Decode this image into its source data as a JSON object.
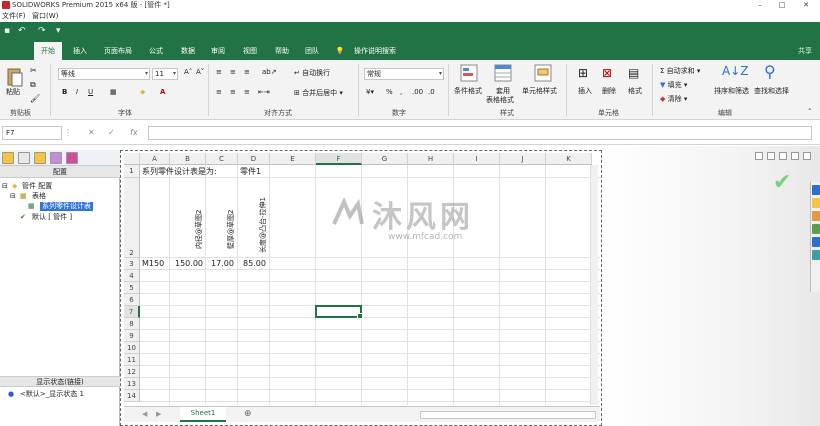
{
  "window": {
    "title": "SOLIDWORKS Premium 2015 x64 版 - [管件 *]"
  },
  "menubar": {
    "items": [
      "文件(F)",
      "窗口(W)"
    ]
  },
  "ribbon": {
    "tabs": [
      "开始",
      "插入",
      "页面布局",
      "公式",
      "数据",
      "审阅",
      "视图",
      "帮助",
      "团队",
      "操作说明搜索"
    ],
    "share": "共享",
    "clipboard": {
      "paste": "粘贴",
      "label": "剪贴板"
    },
    "font": {
      "name": "等线",
      "size": "11",
      "label": "字体",
      "bold": "B",
      "italic": "I",
      "underline": "U"
    },
    "alignment": {
      "wrap": "自动换行",
      "merge": "合并后居中",
      "label": "对齐方式"
    },
    "number": {
      "format": "常规",
      "label": "数字"
    },
    "styles": {
      "conditional": "条件格式",
      "table_a": "套用",
      "table_b": "表格格式",
      "cell_style": "单元格样式",
      "label": "样式"
    },
    "cells": {
      "insert": "插入",
      "delete": "删除",
      "format": "格式",
      "label": "单元格"
    },
    "editing": {
      "autosum": "自动求和",
      "fill": "填充",
      "clear": "清除",
      "sort": "排序和筛选",
      "find": "查找和选择",
      "label": "编辑"
    }
  },
  "formula_bar": {
    "name_box": "F7",
    "value": ""
  },
  "config_panel": {
    "header": "配置",
    "tree": [
      "管件 配置",
      "表格",
      "系列零件设计表",
      "默认 [ 管件 ]"
    ],
    "display_state_header": "显示状态(链接)",
    "display_state_item": "<默认>_显示状态 1"
  },
  "sheet": {
    "columns": [
      "A",
      "B",
      "C",
      "D",
      "E",
      "F",
      "G",
      "H",
      "I",
      "J",
      "K"
    ],
    "rows": [
      "1",
      "2",
      "3",
      "4",
      "5",
      "6",
      "7",
      "8",
      "9",
      "10",
      "11",
      "12",
      "13",
      "14"
    ],
    "title_cell": "系列零件设计表是为:",
    "title_part": "零件1",
    "headers": [
      "内径@草图2",
      "壁厚@草图2",
      "长度@凸台-拉伸1"
    ],
    "data_row": [
      "M150",
      "150.00",
      "17.00",
      "85.00"
    ],
    "tab": "Sheet1",
    "selected_cell": "F7"
  },
  "watermark": {
    "text": "沐风网",
    "url": "www.mfcad.com"
  },
  "colors": {
    "accent": "#217346",
    "selection": "#3176d6"
  }
}
